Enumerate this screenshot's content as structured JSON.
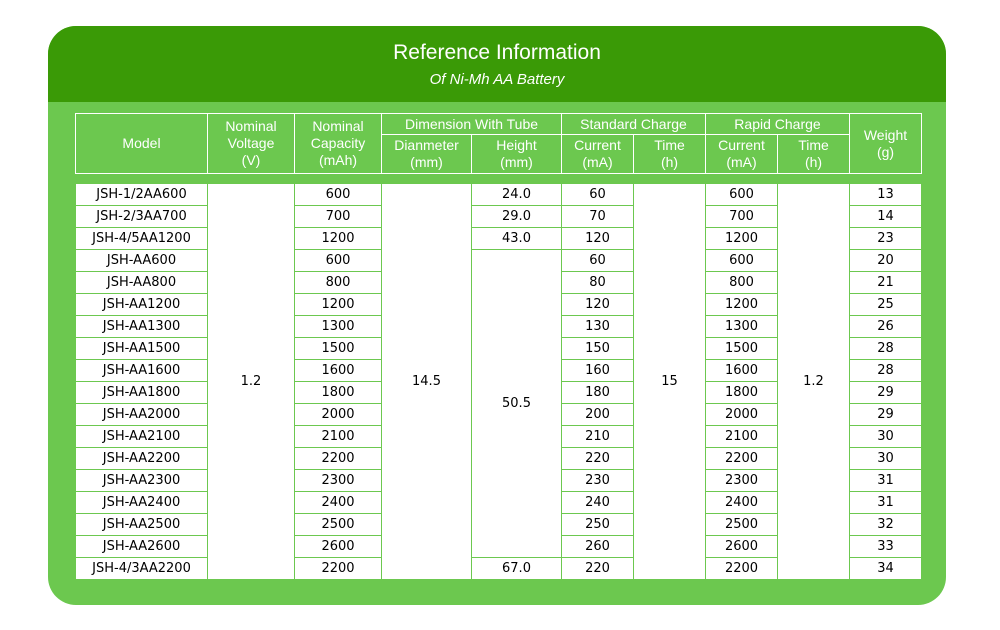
{
  "header": {
    "title": "Reference Information",
    "subtitle": "Of Ni-Mh AA Battery"
  },
  "columns": {
    "model": "Model",
    "nominal_voltage": [
      "Nominal",
      "Voltage",
      "(V)"
    ],
    "nominal_capacity": [
      "Nominal",
      "Capacity",
      "(mAh)"
    ],
    "dimension_group": "Dimension With Tube",
    "dimension_diameter": [
      "Dianmeter",
      "(mm)"
    ],
    "dimension_height": [
      "Height",
      "(mm)"
    ],
    "standard_group": "Standard Charge",
    "standard_current": [
      "Current",
      "(mA)"
    ],
    "standard_time": [
      "Time",
      "(h)"
    ],
    "rapid_group": "Rapid Charge",
    "rapid_current": [
      "Current",
      "(mA)"
    ],
    "rapid_time": [
      "Time",
      "(h)"
    ],
    "weight": [
      "Weight",
      "(g)"
    ]
  },
  "shared": {
    "nominal_voltage": "1.2",
    "diameter": "14.5",
    "height_common": "50.5",
    "standard_time": "15",
    "rapid_time": "1.2"
  },
  "rows": [
    {
      "model": "JSH-1/2AA600",
      "capacity": "600",
      "height": "24.0",
      "std_current": "60",
      "rapid_current": "600",
      "weight": "13"
    },
    {
      "model": "JSH-2/3AA700",
      "capacity": "700",
      "height": "29.0",
      "std_current": "70",
      "rapid_current": "700",
      "weight": "14"
    },
    {
      "model": "JSH-4/5AA1200",
      "capacity": "1200",
      "height": "43.0",
      "std_current": "120",
      "rapid_current": "1200",
      "weight": "23"
    },
    {
      "model": "JSH-AA600",
      "capacity": "600",
      "std_current": "60",
      "rapid_current": "600",
      "weight": "20"
    },
    {
      "model": "JSH-AA800",
      "capacity": "800",
      "std_current": "80",
      "rapid_current": "800",
      "weight": "21"
    },
    {
      "model": "JSH-AA1200",
      "capacity": "1200",
      "std_current": "120",
      "rapid_current": "1200",
      "weight": "25"
    },
    {
      "model": "JSH-AA1300",
      "capacity": "1300",
      "std_current": "130",
      "rapid_current": "1300",
      "weight": "26"
    },
    {
      "model": "JSH-AA1500",
      "capacity": "1500",
      "std_current": "150",
      "rapid_current": "1500",
      "weight": "28"
    },
    {
      "model": "JSH-AA1600",
      "capacity": "1600",
      "std_current": "160",
      "rapid_current": "1600",
      "weight": "28"
    },
    {
      "model": "JSH-AA1800",
      "capacity": "1800",
      "std_current": "180",
      "rapid_current": "1800",
      "weight": "29"
    },
    {
      "model": "JSH-AA2000",
      "capacity": "2000",
      "std_current": "200",
      "rapid_current": "2000",
      "weight": "29"
    },
    {
      "model": "JSH-AA2100",
      "capacity": "2100",
      "std_current": "210",
      "rapid_current": "2100",
      "weight": "30"
    },
    {
      "model": "JSH-AA2200",
      "capacity": "2200",
      "std_current": "220",
      "rapid_current": "2200",
      "weight": "30"
    },
    {
      "model": "JSH-AA2300",
      "capacity": "2300",
      "std_current": "230",
      "rapid_current": "2300",
      "weight": "31"
    },
    {
      "model": "JSH-AA2400",
      "capacity": "2400",
      "std_current": "240",
      "rapid_current": "2400",
      "weight": "31"
    },
    {
      "model": "JSH-AA2500",
      "capacity": "2500",
      "std_current": "250",
      "rapid_current": "2500",
      "weight": "32"
    },
    {
      "model": "JSH-AA2600",
      "capacity": "2600",
      "std_current": "260",
      "rapid_current": "2600",
      "weight": "33"
    },
    {
      "model": "JSH-4/3AA2200",
      "capacity": "2200",
      "height": "67.0",
      "std_current": "220",
      "rapid_current": "2200",
      "weight": "34"
    }
  ]
}
